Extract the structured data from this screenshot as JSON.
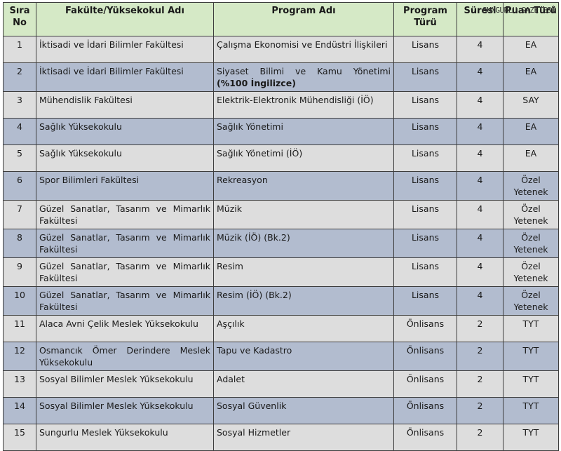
{
  "watermark": "SUNGURLU GAZETESİ",
  "columns": {
    "no": "Sıra No",
    "faculty": "Fakülte/Yüksekokul Adı",
    "program": "Program Adı",
    "type": "Program Türü",
    "duration": "Süresi",
    "score": "Puan Türü"
  },
  "rows": [
    {
      "no": "1",
      "faculty": "İktisadi ve İdari Bilimler Fakültesi",
      "program": "Çalışma Ekonomisi ve Endüstri İlişkileri",
      "program_bold": "",
      "type": "Lisans",
      "duration": "4",
      "score": "EA"
    },
    {
      "no": "2",
      "faculty": "İktisadi ve İdari Bilimler Fakültesi",
      "program": "Siyaset Bilimi ve Kamu Yönetimi ",
      "program_bold": "(%100 İngilizce)",
      "type": "Lisans",
      "duration": "4",
      "score": "EA"
    },
    {
      "no": "3",
      "faculty": "Mühendislik Fakültesi",
      "program": "Elektrik-Elektronik Mühendisliği (İÖ)",
      "program_bold": "",
      "type": "Lisans",
      "duration": "4",
      "score": "SAY"
    },
    {
      "no": "4",
      "faculty": "Sağlık Yüksekokulu",
      "program": "Sağlık Yönetimi",
      "program_bold": "",
      "type": "Lisans",
      "duration": "4",
      "score": "EA"
    },
    {
      "no": "5",
      "faculty": "Sağlık Yüksekokulu",
      "program": "Sağlık Yönetimi (İÖ)",
      "program_bold": "",
      "type": "Lisans",
      "duration": "4",
      "score": "EA"
    },
    {
      "no": "6",
      "faculty": "Spor Bilimleri Fakültesi",
      "program": "Rekreasyon",
      "program_bold": "",
      "type": "Lisans",
      "duration": "4",
      "score": "Özel Yetenek"
    },
    {
      "no": "7",
      "faculty": "Güzel Sanatlar, Tasarım ve Mimarlık Fakültesi",
      "program": "Müzik",
      "program_bold": "",
      "type": "Lisans",
      "duration": "4",
      "score": "Özel Yetenek"
    },
    {
      "no": "8",
      "faculty": "Güzel Sanatlar, Tasarım ve Mimarlık Fakültesi",
      "program": "Müzik (İÖ) (Bk.2)",
      "program_bold": "",
      "type": "Lisans",
      "duration": "4",
      "score": "Özel Yetenek"
    },
    {
      "no": "9",
      "faculty": "Güzel Sanatlar, Tasarım ve Mimarlık Fakültesi",
      "program": "Resim",
      "program_bold": "",
      "type": "Lisans",
      "duration": "4",
      "score": "Özel Yetenek"
    },
    {
      "no": "10",
      "faculty": "Güzel Sanatlar, Tasarım ve Mimarlık Fakültesi",
      "program": "Resim (İÖ) (Bk.2)",
      "program_bold": "",
      "type": "Lisans",
      "duration": "4",
      "score": "Özel Yetenek"
    },
    {
      "no": "11",
      "faculty": "Alaca Avni Çelik Meslek Yüksekokulu",
      "program": "Aşçılık",
      "program_bold": "",
      "type": "Önlisans",
      "duration": "2",
      "score": "TYT"
    },
    {
      "no": "12",
      "faculty": "Osmancık Ömer Derindere Meslek Yüksekokulu",
      "program": "Tapu ve Kadastro",
      "program_bold": "",
      "type": "Önlisans",
      "duration": "2",
      "score": "TYT"
    },
    {
      "no": "13",
      "faculty": "Sosyal Bilimler Meslek Yüksekokulu",
      "program": "Adalet",
      "program_bold": "",
      "type": "Önlisans",
      "duration": "2",
      "score": "TYT"
    },
    {
      "no": "14",
      "faculty": "Sosyal Bilimler Meslek Yüksekokulu",
      "program": "Sosyal Güvenlik",
      "program_bold": "",
      "type": "Önlisans",
      "duration": "2",
      "score": "TYT"
    },
    {
      "no": "15",
      "faculty": "Sungurlu Meslek Yüksekokulu",
      "program": "Sosyal Hizmetler",
      "program_bold": "",
      "type": "Önlisans",
      "duration": "2",
      "score": "TYT"
    }
  ]
}
